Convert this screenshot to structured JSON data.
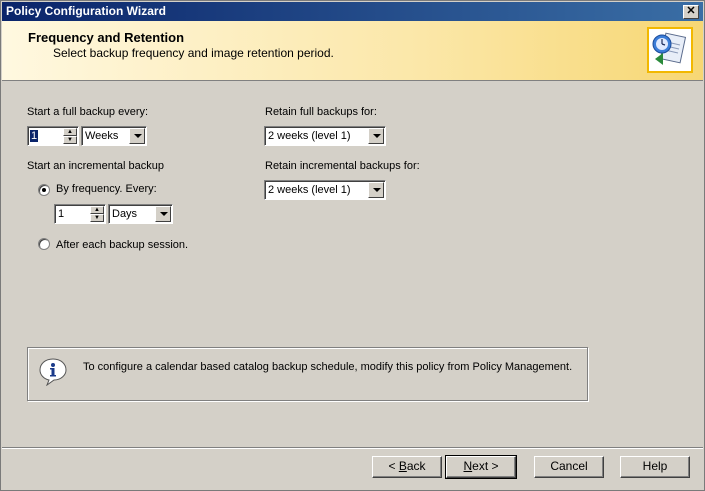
{
  "window": {
    "title": "Policy Configuration Wizard",
    "close_label": "✕"
  },
  "header": {
    "title": "Frequency and Retention",
    "subtitle": "Select backup frequency and image retention period."
  },
  "full_backup": {
    "label": "Start a full backup every:",
    "value": "1",
    "unit": "Weeks"
  },
  "incremental": {
    "label": "Start an incremental backup",
    "by_frequency_label": "By frequency. Every:",
    "by_frequency_selected": true,
    "value": "1",
    "unit": "Days",
    "after_session_label": "After each backup session."
  },
  "retain_full": {
    "label": "Retain full backups for:",
    "value": "2 weeks (level 1)"
  },
  "retain_incremental": {
    "label": "Retain incremental backups for:",
    "value": "2 weeks (level 1)"
  },
  "info": {
    "text": "To configure a calendar based catalog backup schedule, modify this policy from Policy Management."
  },
  "buttons": {
    "back_prefix": "< ",
    "back_mnemonic": "B",
    "back_rest": "ack",
    "next_mnemonic": "N",
    "next_rest": "ext >",
    "cancel": "Cancel",
    "help": "Help"
  }
}
